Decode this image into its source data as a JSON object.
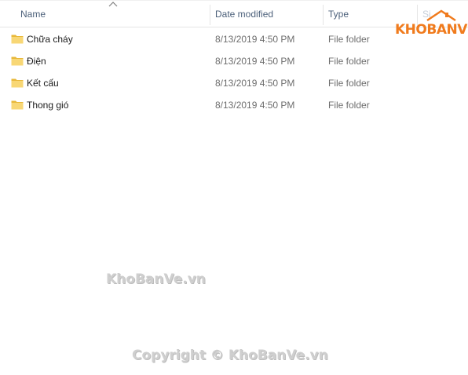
{
  "columns": {
    "name": "Name",
    "date_modified": "Date modified",
    "type": "Type",
    "size": "Si"
  },
  "files": [
    {
      "name": "Chữa cháy",
      "date": "8/13/2019 4:50 PM",
      "type": "File folder",
      "icon": "folder-icon"
    },
    {
      "name": "Điện",
      "date": "8/13/2019 4:50 PM",
      "type": "File folder",
      "icon": "folder-icon"
    },
    {
      "name": "Kết cấu",
      "date": "8/13/2019 4:50 PM",
      "type": "File folder",
      "icon": "folder-icon"
    },
    {
      "name": "Thong gió",
      "date": "8/13/2019 4:50 PM",
      "type": "File folder",
      "icon": "folder-icon"
    }
  ],
  "logo": {
    "part1": "KHO",
    "part2": "BANVE",
    "color": "#f07b1d"
  },
  "watermarks": {
    "middle": "KhoBanVe.vn",
    "bottom": "Copyright © KhoBanVe.vn"
  },
  "colors": {
    "folder": "#f8d775",
    "folder_dark": "#e8b83a",
    "header_text": "#4c607a"
  }
}
